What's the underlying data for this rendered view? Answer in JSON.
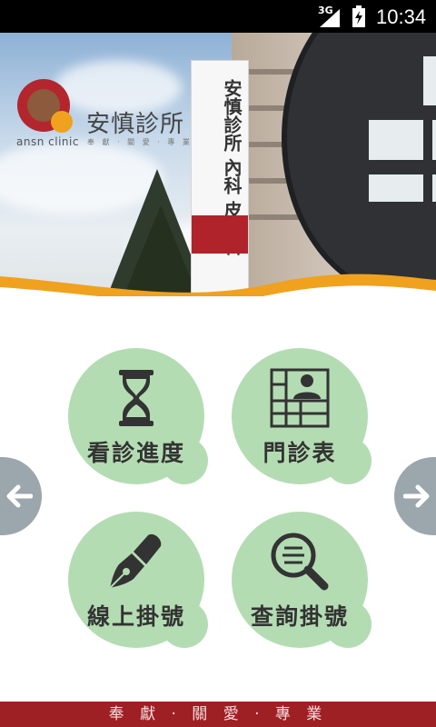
{
  "status_bar": {
    "network": "3G",
    "time": "10:34"
  },
  "header": {
    "logo_text": "ansn clinic",
    "brand_name": "安慎診所",
    "small_tagline": "奉 獻 · 關 愛 · 專 業",
    "sign_text": "安慎診所 內科 皮膚科"
  },
  "menu": [
    {
      "label": "看診進度",
      "icon": "hourglass-icon"
    },
    {
      "label": "門診表",
      "icon": "schedule-grid-icon"
    },
    {
      "label": "線上掛號",
      "icon": "fountain-pen-icon"
    },
    {
      "label": "查詢掛號",
      "icon": "magnifier-icon"
    }
  ],
  "navigation": {
    "prev_icon": "arrow-left-icon",
    "next_icon": "arrow-right-icon"
  },
  "footer": {
    "tagline": "奉 獻 · 關 愛 · 專 業"
  },
  "colors": {
    "accent_orange": "#f0a11e",
    "blob_green": "#b4dcb3",
    "footer_red": "#9e1f24",
    "logo_red": "#b3262d"
  }
}
